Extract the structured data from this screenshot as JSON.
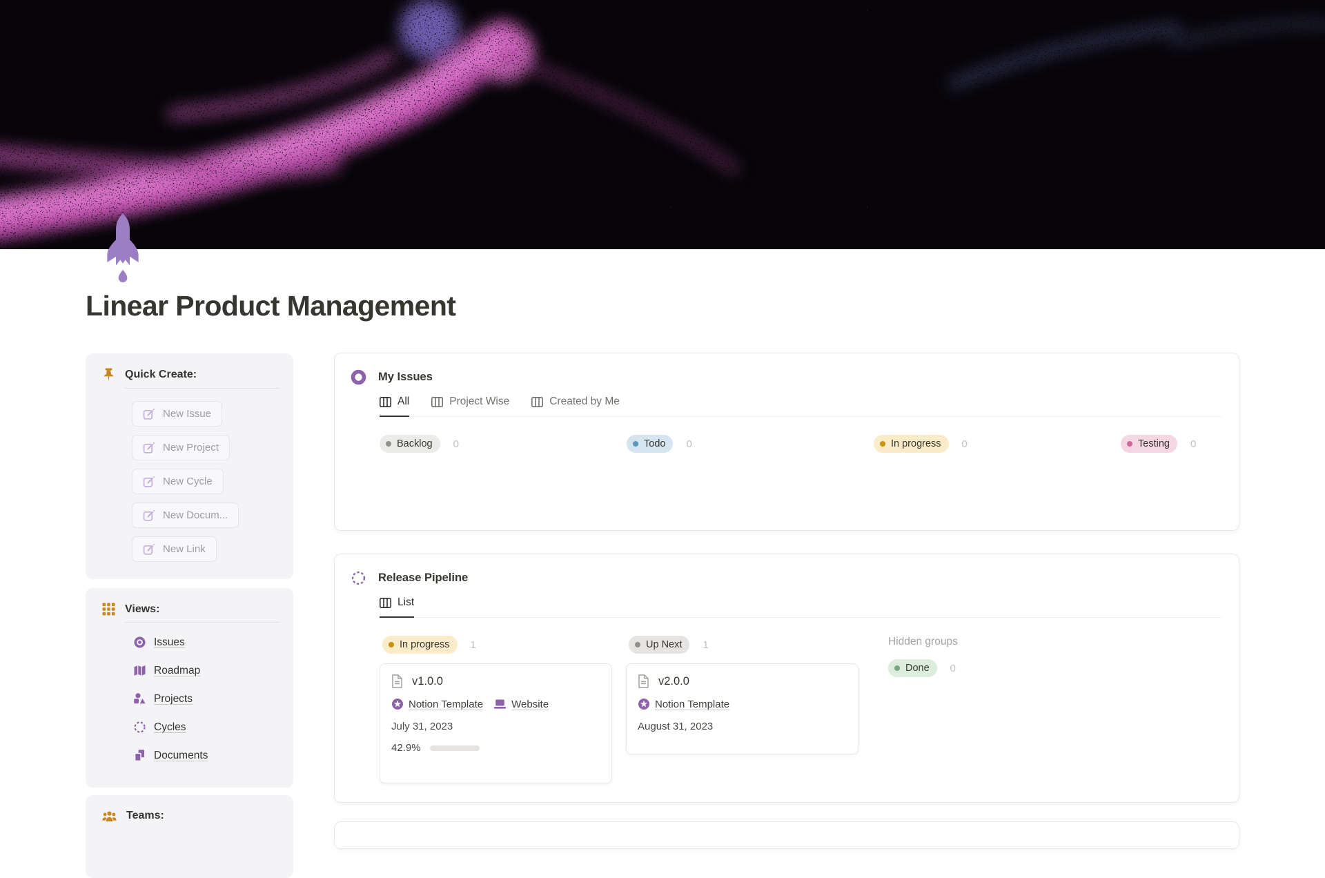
{
  "page": {
    "title": "Linear Product Management"
  },
  "banner": {
    "bg": "#070509",
    "nebula_pink": "#c653b4",
    "nebula_core": "#e07fd2",
    "nebula_violet": "#8672d6",
    "star": "#ffffff"
  },
  "rocket": {
    "color": "#9b7ec4"
  },
  "accent": {
    "purple": "#8d62aa",
    "gold": "#c8871e",
    "progress_green": "#598f6d"
  },
  "sidebar": {
    "quick_create": {
      "title": "Quick Create:",
      "buttons": [
        {
          "label": "New Issue"
        },
        {
          "label": "New Project"
        },
        {
          "label": "New Cycle"
        },
        {
          "label": "New Docum..."
        },
        {
          "label": "New Link"
        }
      ]
    },
    "views": {
      "title": "Views:",
      "items": [
        {
          "label": "Issues"
        },
        {
          "label": "Roadmap"
        },
        {
          "label": "Projects"
        },
        {
          "label": "Cycles"
        },
        {
          "label": "Documents"
        }
      ]
    },
    "teams": {
      "title": "Teams:"
    }
  },
  "my_issues": {
    "title": "My Issues",
    "tabs": [
      {
        "label": "All"
      },
      {
        "label": "Project Wise"
      },
      {
        "label": "Created by Me"
      }
    ],
    "groups": [
      {
        "label": "Backlog",
        "count": "0",
        "bg": "#ebebea",
        "dot": "#91918e"
      },
      {
        "label": "Todo",
        "count": "0",
        "bg": "#d5e5ef",
        "dot": "#5a97bb"
      },
      {
        "label": "In progress",
        "count": "0",
        "bg": "#fbecc9",
        "dot": "#c9910d"
      },
      {
        "label": "Testing",
        "count": "0",
        "bg": "#f5d7e3",
        "dot": "#d2679c"
      }
    ]
  },
  "release_pipeline": {
    "title": "Release Pipeline",
    "tabs": [
      {
        "label": "List"
      }
    ],
    "hidden_groups_label": "Hidden groups",
    "columns": [
      {
        "label": "In progress",
        "count": "1",
        "bg": "#fbecc9",
        "dot": "#c9910d"
      },
      {
        "label": "Up Next",
        "count": "1",
        "bg": "#e5e4e2",
        "dot": "#90908d"
      },
      {
        "label": "Done",
        "count": "0",
        "bg": "#dcecdd",
        "dot": "#77a87f"
      }
    ],
    "cards": [
      {
        "title": "v1.0.0",
        "tags": [
          {
            "label": "Notion Template"
          },
          {
            "label": "Website"
          }
        ],
        "date": "July 31, 2023",
        "progress_label": "42.9%"
      },
      {
        "title": "v2.0.0",
        "tags": [
          {
            "label": "Notion Template"
          }
        ],
        "date": "August 31, 2023"
      }
    ]
  }
}
